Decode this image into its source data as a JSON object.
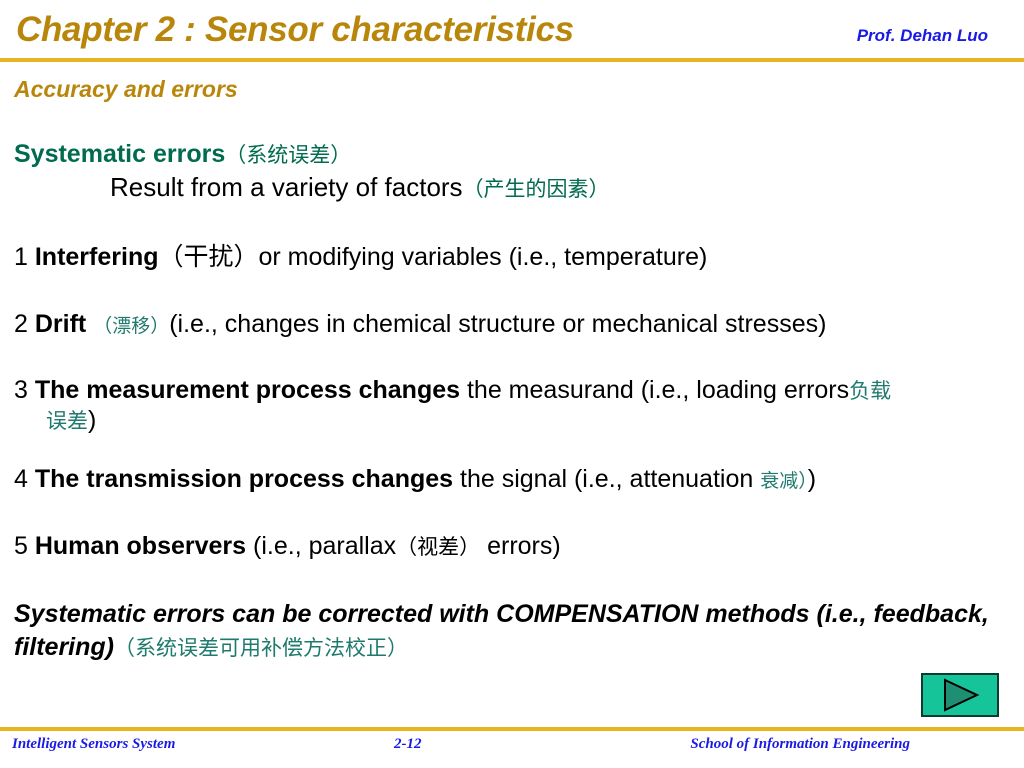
{
  "header": {
    "title": "Chapter 2 : Sensor characteristics",
    "author": "Prof. Dehan Luo"
  },
  "section": {
    "heading": "Accuracy and errors"
  },
  "content": {
    "systematic_label": "Systematic errors",
    "systematic_cn": "（系统误差）",
    "result_text": "Result from a variety of factors",
    "result_cn": "（产生的因素）",
    "item1": {
      "number": "1",
      "bold": "Interfering",
      "cn": "（干扰）",
      "rest": "or modifying variables (i.e., temperature)"
    },
    "item2": {
      "number": "2",
      "bold": "Drift",
      "cn": "（漂移）",
      "rest": "(i.e., changes in chemical structure or mechanical stresses)"
    },
    "item3": {
      "number": "3",
      "bold": "The measurement process changes",
      "rest": "the measurand (i.e., loading errors",
      "cn": "负载",
      "cn_wrap": "误差",
      "close": ")"
    },
    "item4": {
      "number": "4",
      "bold": "The transmission process changes",
      "rest": "the signal (i.e., attenuation ",
      "cn": "衰减）",
      "close": ")"
    },
    "item5": {
      "number": "5",
      "bold": "Human observers",
      "rest_a": "(i.e., parallax",
      "cn": "（视差）",
      "rest_b": "errors)"
    },
    "final": {
      "text": "Systematic errors can be corrected with COMPENSATION methods (i.e., feedback, filtering)",
      "cn": "（系统误差可用补偿方法校正）"
    }
  },
  "footer": {
    "left": "Intelligent Sensors System",
    "center": "2-12",
    "right": "School of Information Engineering"
  },
  "colors": {
    "title_gold": "#B8860B",
    "rule_gold": "#E8B520",
    "author_blue": "#1A1AE6",
    "teal": "#006B4F",
    "teal_cn": "#1F7A6E",
    "button_fill": "#16C49A",
    "button_triangle": "#1E8F72"
  }
}
